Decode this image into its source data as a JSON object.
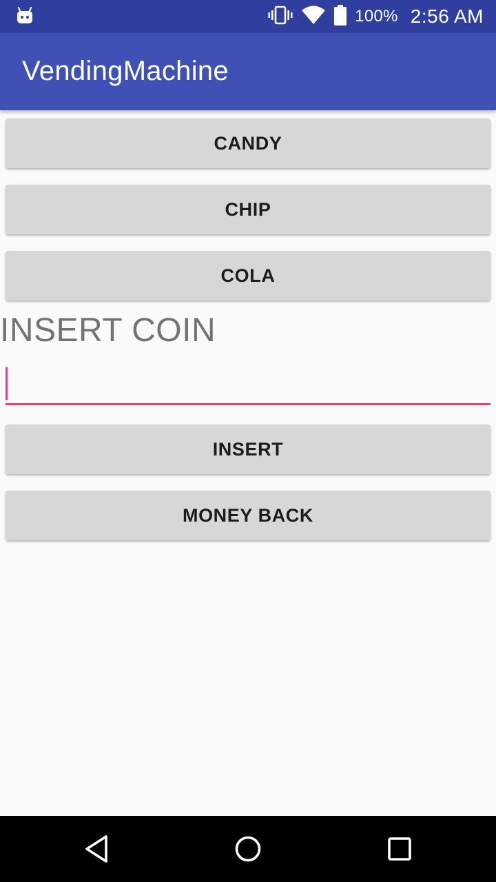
{
  "status_bar": {
    "notification_icon": "android-robot-icon",
    "vibrate_icon": "vibrate-icon",
    "wifi_icon": "wifi-icon",
    "battery_icon": "battery-icon",
    "battery_percent": "100%",
    "time": "2:56 AM",
    "background_color": "#303f9f"
  },
  "app_bar": {
    "title": "VendingMachine",
    "background_color": "#3f51b5"
  },
  "products": [
    {
      "label": "CANDY"
    },
    {
      "label": "CHIP"
    },
    {
      "label": "COLA"
    }
  ],
  "coin_section": {
    "label": "INSERT COIN",
    "input_value": "",
    "input_accent_color": "#ec407a"
  },
  "actions": {
    "insert_label": "INSERT",
    "money_back_label": "MONEY BACK"
  },
  "nav_bar": {
    "back_icon": "back-triangle-icon",
    "home_icon": "home-circle-icon",
    "recents_icon": "recents-square-icon"
  }
}
